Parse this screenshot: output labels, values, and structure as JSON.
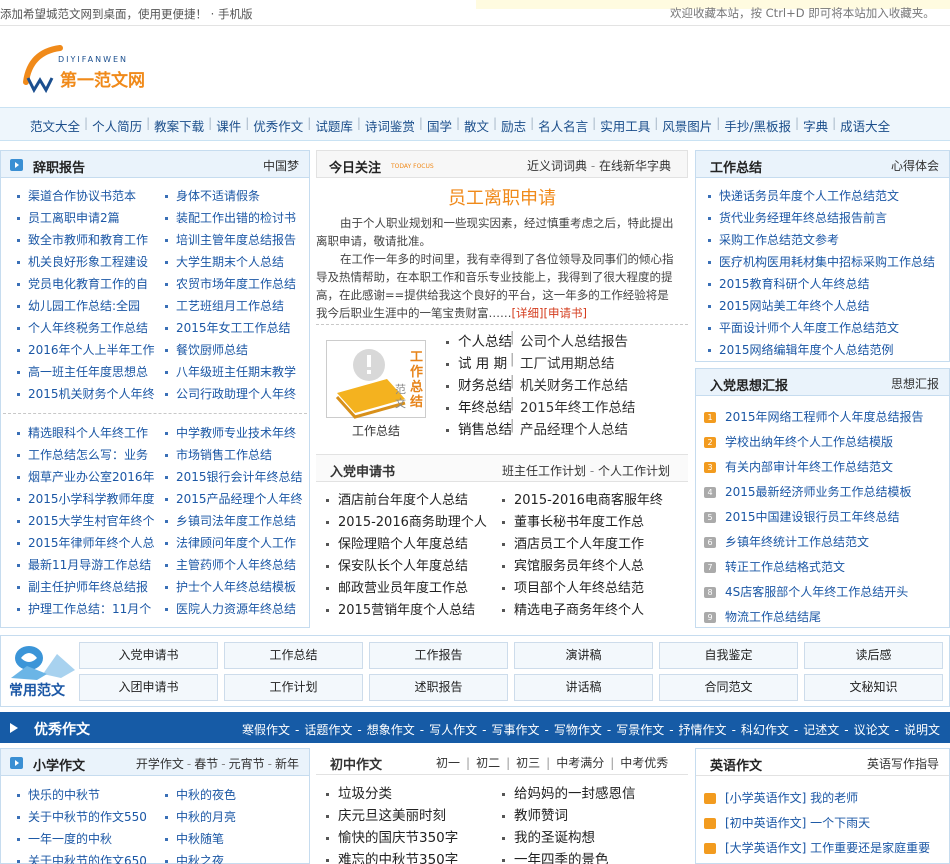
{
  "topbar": {
    "left": "添加希望城范文网到桌面，使用更便捷！  ·  手机版",
    "right": "欢迎收藏本站，按 Ctrl+D 即可将本站加入收藏夹。"
  },
  "logo": {
    "en": "DIYIFANWEN",
    "cn": "第一范文网"
  },
  "nav": [
    "范文大全",
    "个人简历",
    "教案下载",
    "课件",
    "优秀作文",
    "试题库",
    "诗词鉴赏",
    "国学",
    "散文",
    "励志",
    "名人名言",
    "实用工具",
    "风景图片",
    "手抄/黑板报",
    "字典",
    "成语大全"
  ],
  "left": {
    "title": "辞职报告",
    "more": "中国梦",
    "col1": [
      "渠道合作协议书范本",
      "员工离职申请2篇",
      "致全市教师和教育工作",
      "机关良好形象工程建设",
      "党员电化教育工作的自",
      "幼儿园工作总结:全园",
      "个人年终税务工作总结",
      "2016年个人上半年工作",
      "高一班主任年度思想总",
      "2015机关财务个人年终"
    ],
    "col2": [
      "身体不适请假条",
      "装配工作出错的检讨书",
      "培训主管年度总结报告",
      "大学生期末个人总结",
      "农贸市场年度工作总结",
      "工艺班组月工作总结",
      "2015年女工工作总结",
      "餐饮厨师总结",
      "八年级班主任期末教学",
      "公司行政助理个人年终"
    ],
    "col3": [
      "精选眼科个人年终工作",
      "工作总结怎么写：业务",
      "烟草产业办公室2016年",
      "2015小学科学教师年度",
      "2015大学生村官年终个",
      "2015年律师年终个人总",
      "最新11月导游工作总结",
      "副主任护师年终总结报",
      "护理工作总结：11月个"
    ],
    "col4": [
      "中学教师专业技术年终",
      "市场销售工作总结",
      "2015银行会计年终总结",
      "2015产品经理个人年终",
      "乡镇司法年度工作总结",
      "法律顾问年度个人工作",
      "主管药师个人年终总结",
      "护士个人年终总结模板",
      "医院人力资源年终总结"
    ]
  },
  "center": {
    "focus_label": "今日关注",
    "focus_sub": "TODAY FOCUS",
    "focus_links": [
      "近义词词典",
      "在线新华字典"
    ],
    "headline": "员工离职申请",
    "para1": "由于个人职业规划和一些现实因素，经过慎重考虑之后，特此提出离职申请，敬请批准。",
    "para2": "在工作一年多的时间里，我有幸得到了各位领导及同事们的倾心指导及热情帮助，在本职工作和音乐专业技能上，我得到了很大程度的提高，在此感谢==提供给我这个良好的平台，这一年多的工作经验将是我今后职业生涯中的一笔宝贵财富……",
    "detail": "[详细]",
    "apply": "[申请书]",
    "img_caption": "工作总结",
    "img_text": "工作总结范文",
    "cat_left": [
      "个人总结",
      "试 用 期",
      "财务总结",
      "年终总结",
      "销售总结"
    ],
    "cat_right": [
      "公司个人总结报告",
      "工厂试用期总结",
      "机关财务工作总结",
      "2015年终工作总结",
      "产品经理个人总结"
    ],
    "apply_title": "入党申请书",
    "apply_more": [
      "班主任工作计划",
      "个人工作计划"
    ],
    "apply_col1": [
      "酒店前台年度个人总结",
      "2015-2016商务助理个人",
      "保险理赔个人年度总结",
      "保安队长个人年度总结",
      "邮政营业员年度工作总",
      "2015营销年度个人总结"
    ],
    "apply_col2": [
      "2015-2016电商客服年终",
      "董事长秘书年度工作总",
      "酒店员工个人年度工作",
      "宾馆服务员年终个人总",
      "项目部个人年终总结范",
      "精选电子商务年终个人"
    ]
  },
  "right": {
    "title": "工作总结",
    "more": "心得体会",
    "items": [
      "快递话务员年度个人工作总结范文",
      "货代业务经理年终总结报告前言",
      "采购工作总结范文参考",
      "医疗机构医用耗材集中招标采购工作总结",
      "2015教育科研个人年终总结",
      "2015网站美工年终个人总结",
      "平面设计师个人年度工作总结范文",
      "2015网络编辑年度个人总结范例"
    ],
    "title2": "入党思想汇报",
    "more2": "思想汇报",
    "items2": [
      "2015年网络工程师个人年度总结报告",
      "学校出纳年终个人工作总结模版",
      "有关内部审计年终工作总结范文",
      "2015最新经济师业务工作总结模板",
      "2015中国建设银行员工年终总结",
      "乡镇年终统计工作总结范文",
      "转正工作总结格式范文",
      "4S店客服部个人年终工作总结开头",
      "物流工作总结结尾"
    ],
    "nums": [
      "1",
      "2",
      "3",
      "4",
      "5",
      "6",
      "7",
      "8",
      "9"
    ],
    "num_colors": [
      "#f29b1f",
      "#f29b1f",
      "#f29b1f",
      "#aaaaaa",
      "#aaaaaa",
      "#aaaaaa",
      "#aaaaaa",
      "#aaaaaa",
      "#aaaaaa"
    ]
  },
  "common": {
    "label": "常用范文",
    "row1": [
      "入党申请书",
      "工作总结",
      "工作报告",
      "演讲稿",
      "自我鉴定",
      "读后感"
    ],
    "row2": [
      "入团申请书",
      "工作计划",
      "述职报告",
      "讲话稿",
      "合同范文",
      "文秘知识"
    ]
  },
  "excellent": {
    "title": "优秀作文",
    "links": [
      "寒假作文",
      "话题作文",
      "想象作文",
      "写人作文",
      "写事作文",
      "写物作文",
      "写景作文",
      "抒情作文",
      "科幻作文",
      "记述文",
      "议论文",
      "说明文"
    ]
  },
  "bottom": {
    "p1_title": "小学作文",
    "p1_more": [
      "开学作文",
      "春节",
      "元宵节",
      "新年"
    ],
    "p1_col1": [
      "快乐的中秋节",
      "关于中秋节的作文550",
      "一年一度的中秋",
      "关于中秋节的作文650"
    ],
    "p1_col2": [
      "中秋的夜色",
      "中秋的月亮",
      "中秋随笔",
      "中秋之夜"
    ],
    "p2_title": "初中作文",
    "p2_more": [
      "初一",
      "初二",
      "初三",
      "中考满分",
      "中考优秀"
    ],
    "p2_col1": [
      "垃圾分类",
      "庆元旦这美丽时刻",
      "愉快的国庆节350字",
      "难忘的中秋节350字"
    ],
    "p2_col2": [
      "给妈妈的一封感恩信",
      "教师赞词",
      "我的圣诞构想",
      "一年四季的景色"
    ],
    "p3_title": "英语作文",
    "p3_more": "英语写作指导",
    "p3_items": [
      "[小学英语作文] 我的老师",
      "[初中英语作文] 一个下雨天",
      "[大学英语作文] 工作重要还是家庭重要"
    ]
  },
  "colors": {
    "nav_bg": "#eef6fc",
    "bar_bg": "#165ba6",
    "headline": "#f08a1a",
    "link": "#1b57a5",
    "logo_orange": "#f08a1a"
  }
}
